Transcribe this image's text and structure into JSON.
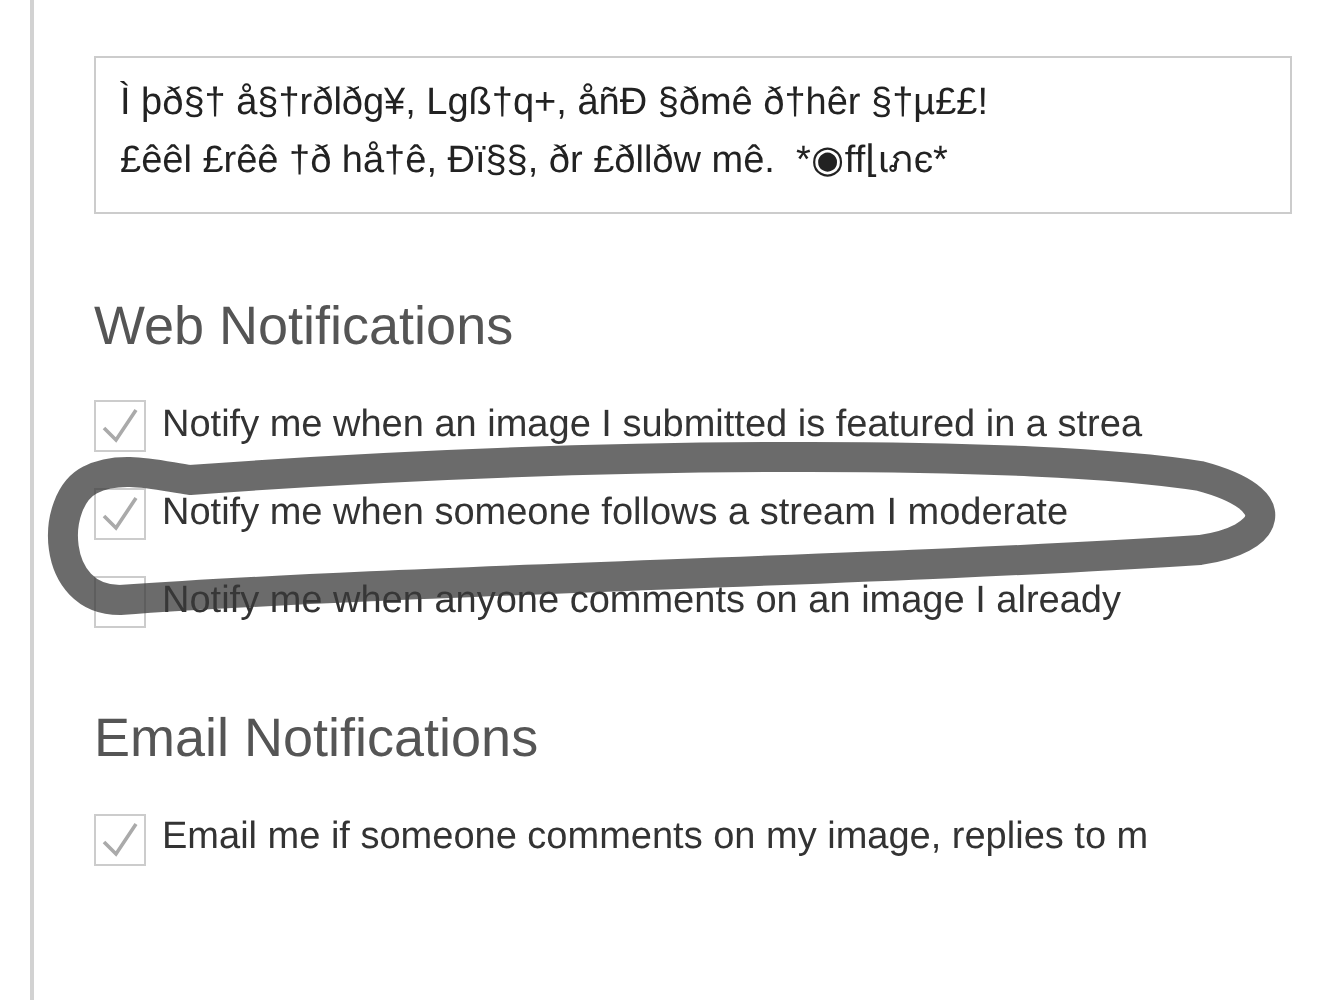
{
  "tagline": {
    "value": "Ì þð§† å§†rðlðg¥, Lgß†q+, åñÐ §ðmê ð†hêr §†µ££!\n£êêl £rêê †ð hå†ê, Ðï§§, ðr £ðllðw mê.  *◉ff⌊ɩภє*"
  },
  "sections": [
    {
      "heading": "Web Notifications",
      "options": [
        {
          "label": "Notify me when an image I submitted is featured in a strea",
          "checked": true
        },
        {
          "label": "Notify me when someone follows a stream I moderate",
          "checked": true
        },
        {
          "label": "Notify me when anyone comments on an image I already",
          "checked": false
        }
      ]
    },
    {
      "heading": "Email Notifications",
      "options": [
        {
          "label": "Email me if someone comments on my image, replies to m",
          "checked": true
        }
      ]
    }
  ]
}
